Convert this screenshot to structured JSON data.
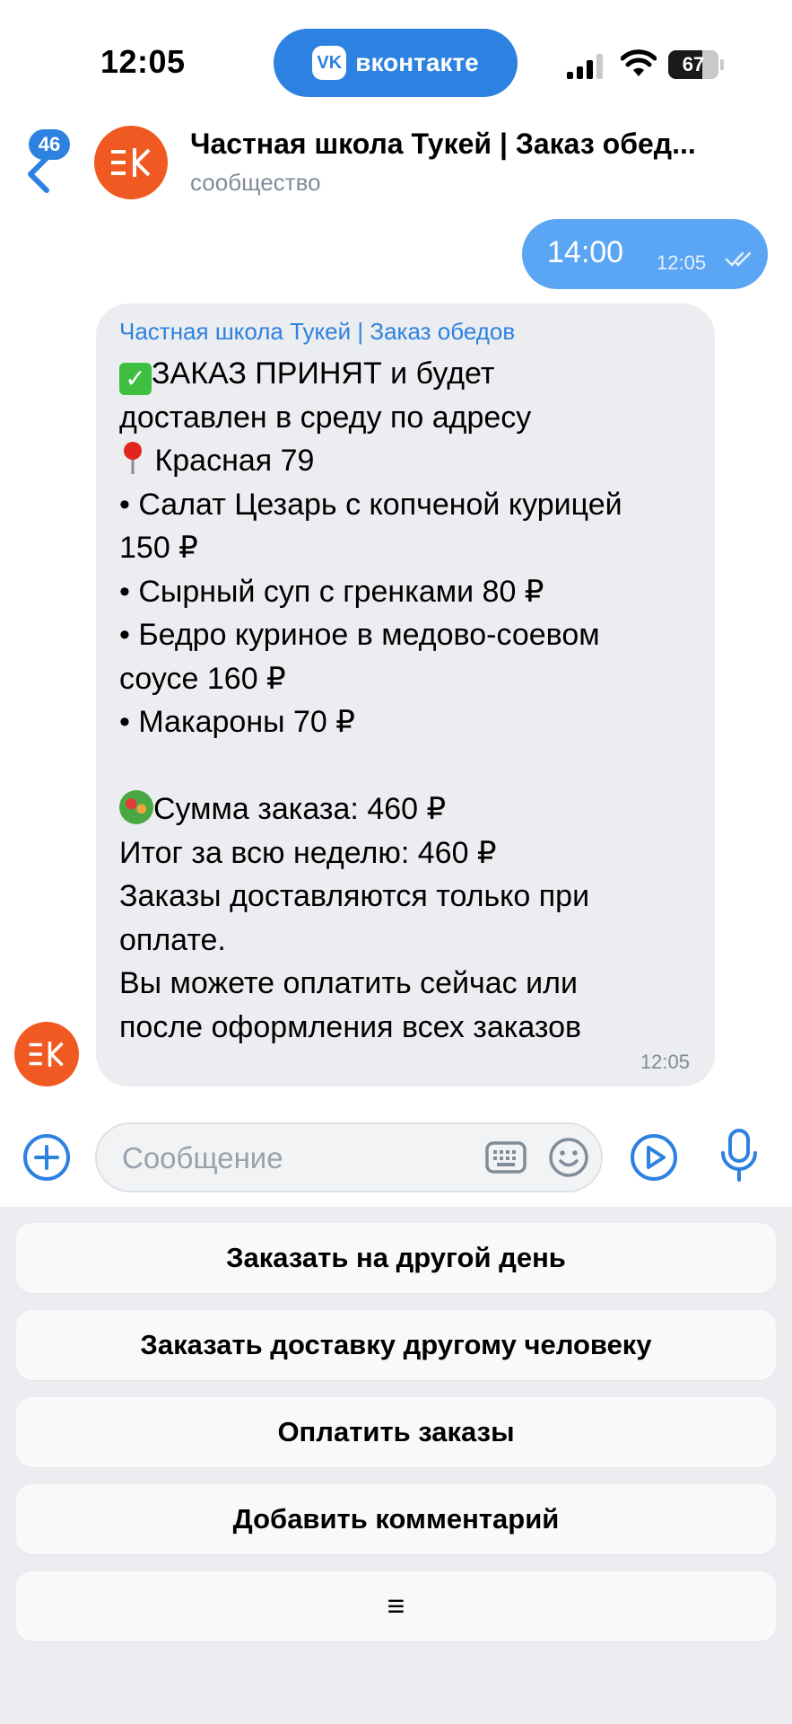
{
  "status_bar": {
    "time": "12:05",
    "app_pill": "вконтакте",
    "battery": "67",
    "battery_level": 0.67
  },
  "header": {
    "unread_count": "46",
    "title": "Частная школа Тукей | Заказ обед...",
    "subtitle": "сообщество"
  },
  "messages": {
    "outgoing": {
      "text": "14:00",
      "time": "12:05"
    },
    "incoming": {
      "sender": "Частная школа Тукей | Заказ обедов",
      "lines": [
        "ЗАКАЗ ПРИНЯТ и будет",
        "доставлен в среду по адресу",
        " Красная 79",
        "• Салат Цезарь с копченой курицей",
        "150 ₽",
        "• Сырный суп с гренками 80 ₽",
        "• Бедро куриное в медово-соевом",
        "соусе 160 ₽",
        "• Макароны 70 ₽",
        "",
        "Сумма заказа: 460 ₽",
        "Итог за всю неделю: 460 ₽",
        "Заказы доставляются только при",
        "оплате.",
        "Вы можете оплатить сейчас или",
        "после оформления всех заказов"
      ],
      "time": "12:05"
    }
  },
  "composer": {
    "placeholder": "Сообщение"
  },
  "keyboard": {
    "buttons": [
      "Заказать на другой день",
      "Заказать доставку другому человеку",
      "Оплатить заказы",
      "Добавить комментарий",
      "≡"
    ]
  },
  "colors": {
    "accent": "#2d81e0",
    "outgoing_bubble": "#5aa6f4",
    "incoming_bubble": "#ebedf0",
    "brand_orange": "#f05a22"
  }
}
